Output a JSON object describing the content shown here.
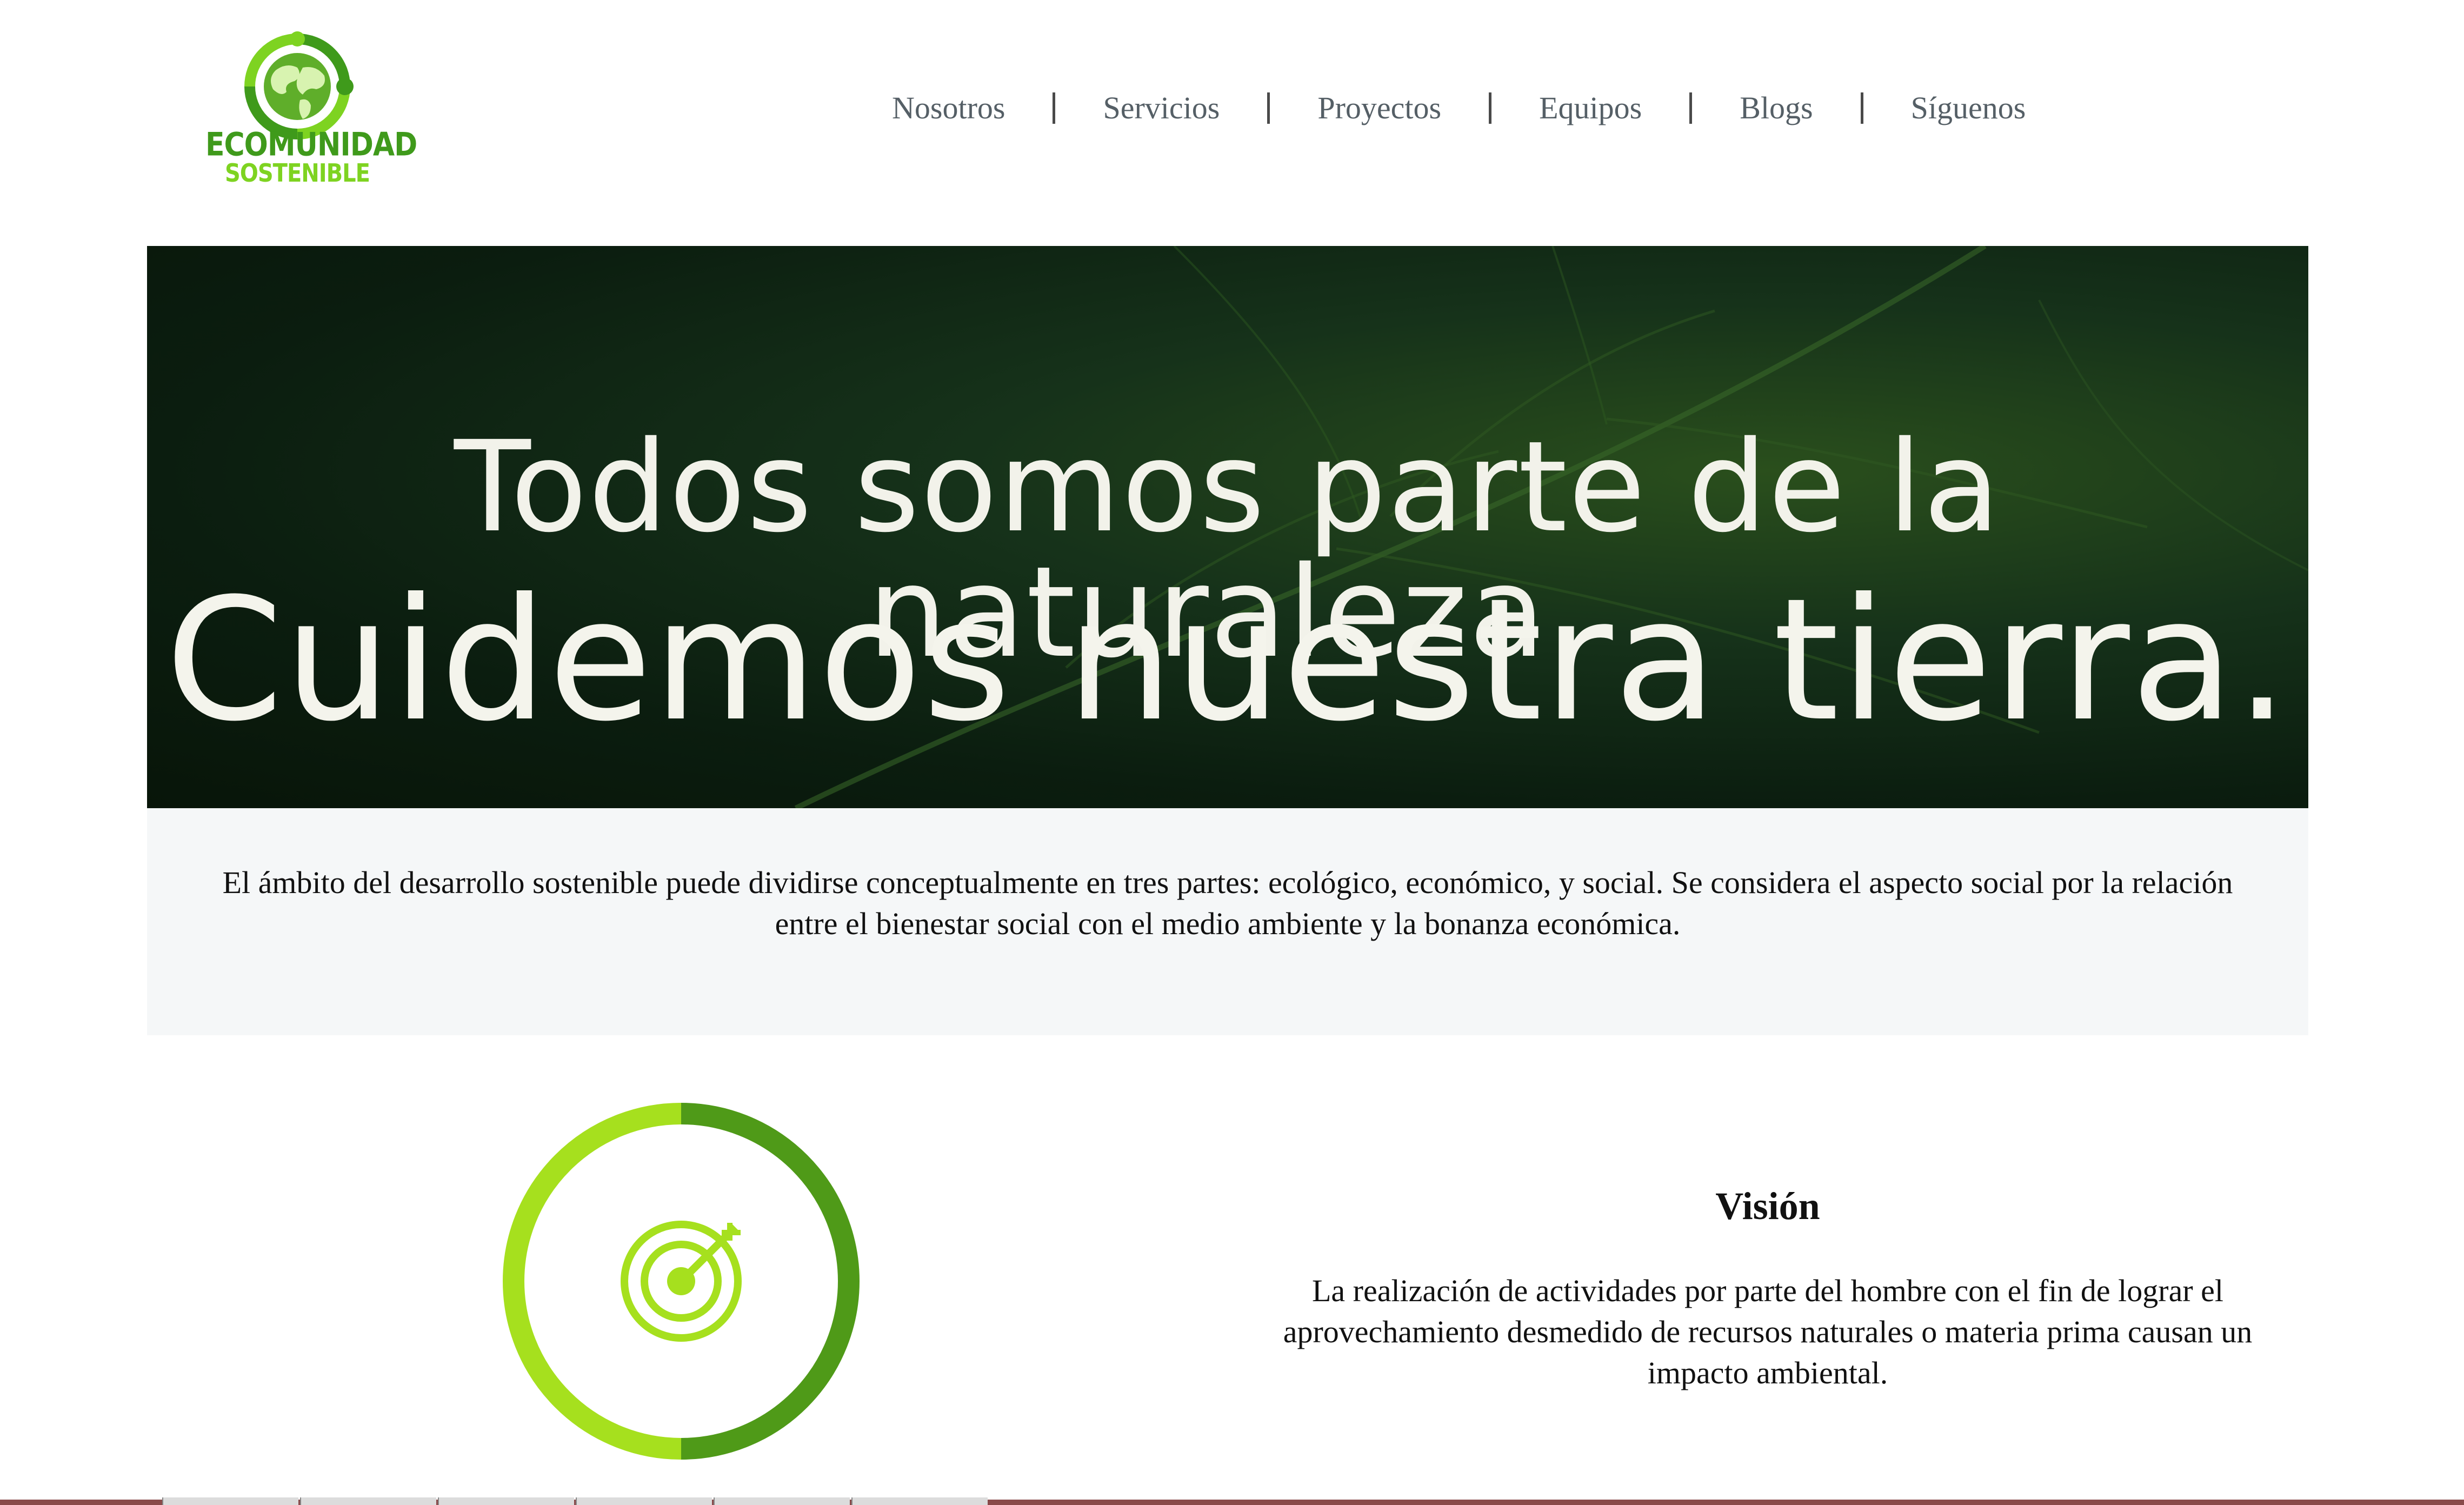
{
  "brand": {
    "line1": "ECOMUNIDAD",
    "line2": "SOSTENIBLE",
    "colors": {
      "dark_green": "#3f9a1b",
      "light_green": "#7ed321"
    }
  },
  "nav": {
    "items": [
      "Nosotros",
      "Servicios",
      "Proyectos",
      "Equipos",
      "Blogs",
      "Síguenos"
    ]
  },
  "hero": {
    "line1": "Todos somos parte de la naturaleza.",
    "line2": "Cuidemos nuestra tierra."
  },
  "intro": {
    "text": "El ámbito del desarrollo sostenible puede dividirse conceptualmente en tres partes: ecológico, económico, y social. Se considera el aspecto social por la relación entre el bienestar social con el medio ambiente y la bonanza económica."
  },
  "vision": {
    "icon": "target-icon",
    "title": "Visión",
    "text": "La realización de actividades por parte del hombre con el fin de lograr el aprovechamiento desmedido de recursos naturales o materia prima causan un impacto ambiental."
  }
}
